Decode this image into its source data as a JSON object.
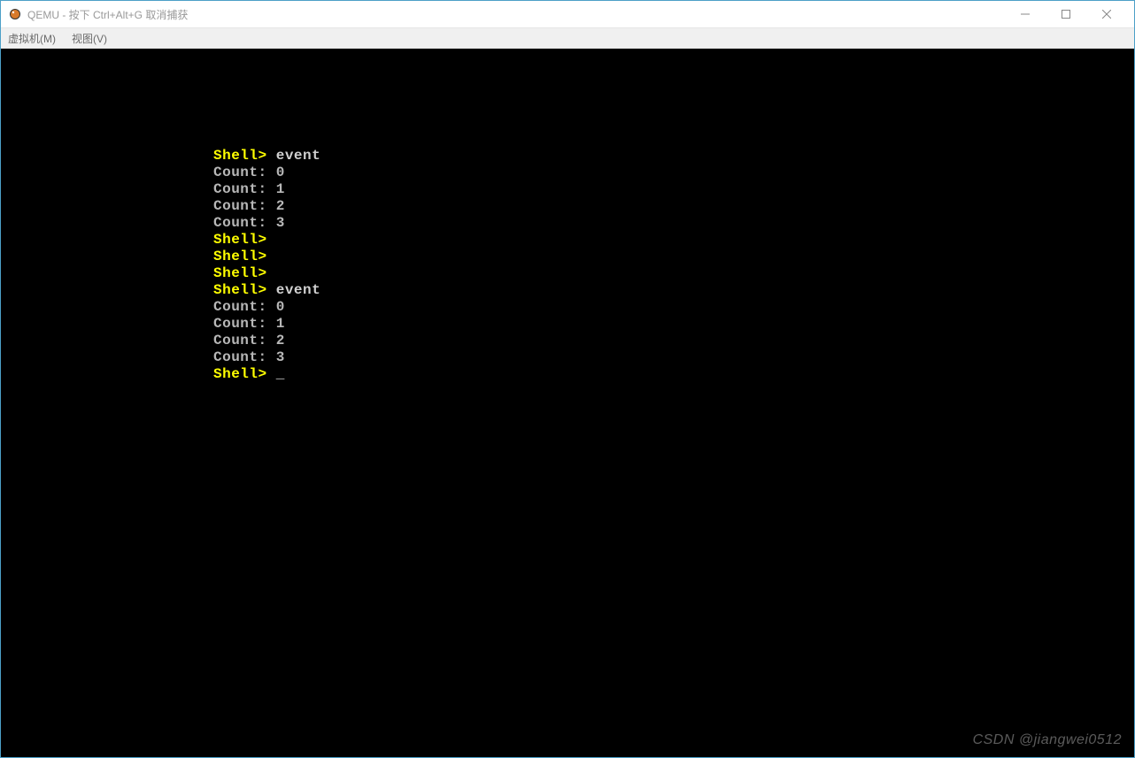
{
  "titlebar": {
    "title": "QEMU - 按下 Ctrl+Alt+G 取消捕获"
  },
  "menubar": {
    "items": [
      {
        "label": "虚拟机(M)"
      },
      {
        "label": "视图(V)"
      }
    ]
  },
  "terminal": {
    "prompt_text": "Shell>",
    "cursor": "_",
    "lines": [
      {
        "type": "cmd",
        "prompt": "Shell>",
        "text": " event"
      },
      {
        "type": "output",
        "text": "Count: 0"
      },
      {
        "type": "output",
        "text": "Count: 1"
      },
      {
        "type": "output",
        "text": "Count: 2"
      },
      {
        "type": "output",
        "text": "Count: 3"
      },
      {
        "type": "prompt",
        "prompt": "Shell>",
        "text": " "
      },
      {
        "type": "prompt",
        "prompt": "Shell>",
        "text": " "
      },
      {
        "type": "prompt",
        "prompt": "Shell>",
        "text": " "
      },
      {
        "type": "cmd",
        "prompt": "Shell>",
        "text": " event"
      },
      {
        "type": "output",
        "text": "Count: 0"
      },
      {
        "type": "output",
        "text": "Count: 1"
      },
      {
        "type": "output",
        "text": "Count: 2"
      },
      {
        "type": "output",
        "text": "Count: 3"
      },
      {
        "type": "cursor",
        "prompt": "Shell>",
        "text": " _"
      }
    ]
  },
  "watermark": "CSDN @jiangwei0512"
}
